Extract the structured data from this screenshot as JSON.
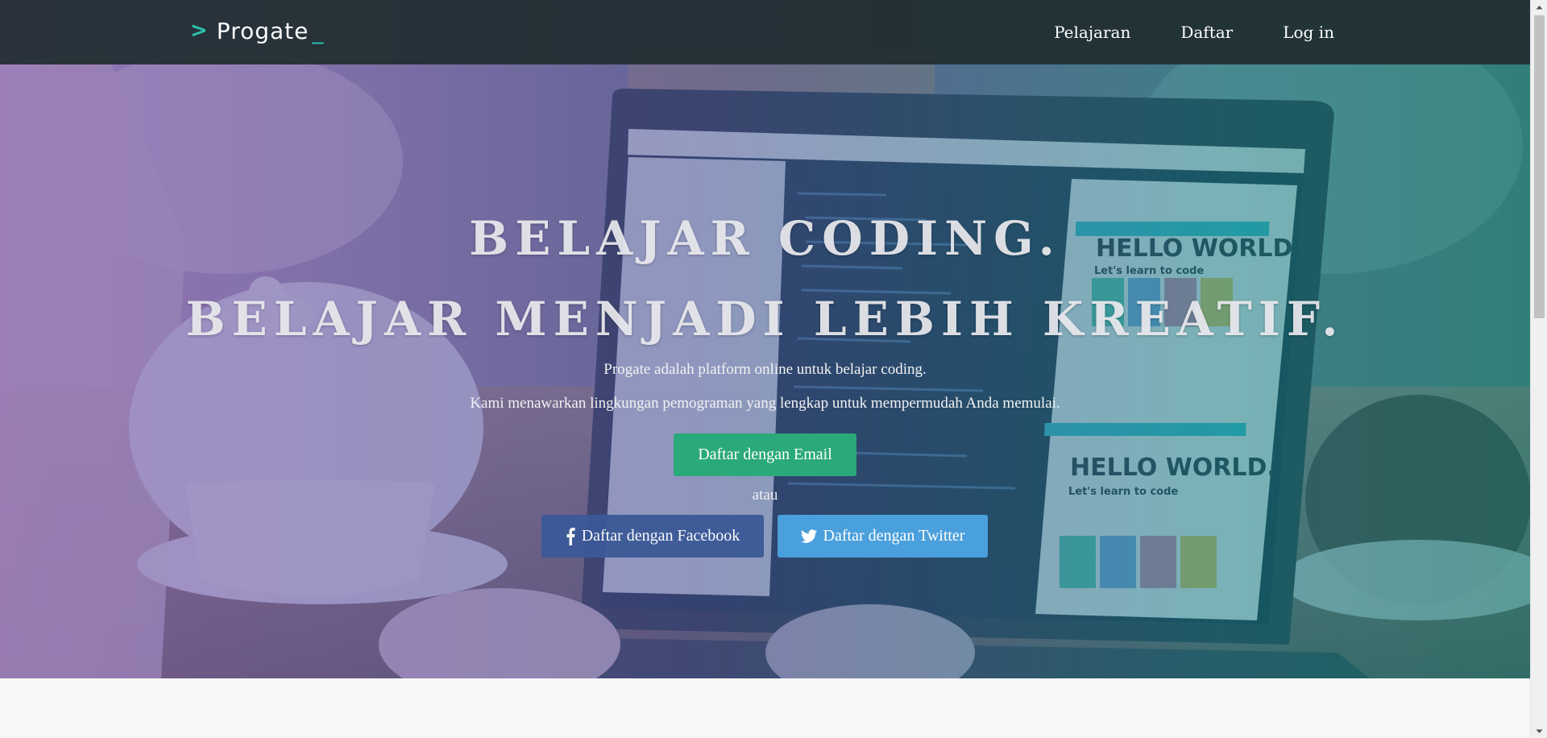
{
  "navbar": {
    "logo_text": "Progate",
    "links": [
      "Pelajaran",
      "Daftar",
      "Log in"
    ]
  },
  "hero": {
    "headline_1": "BELAJAR CODING.",
    "headline_2": "BELAJAR MENJADI LEBIH KREATIF.",
    "sub_1": "Progate adalah platform online untuk belajar coding.",
    "sub_2": "Kami menawarkan lingkungan pemograman yang lengkap untuk mempermudah Anda memulai.",
    "email_button": "Daftar dengan Email",
    "or_text": "atau",
    "facebook_button": "Daftar dengan Facebook",
    "twitter_button": "Daftar dengan Twitter"
  },
  "colors": {
    "navbar_bg": "#202c30",
    "logo_accent": "#29c4b0",
    "email_button": "#2aa97a",
    "facebook_button": "#3b5998",
    "twitter_button": "#4aa0dc"
  },
  "icons": {
    "logo": "chevron-right-icon",
    "facebook": "facebook-icon",
    "twitter": "twitter-icon",
    "scroll_up": "chevron-up-icon",
    "scroll_down": "chevron-down-icon"
  }
}
